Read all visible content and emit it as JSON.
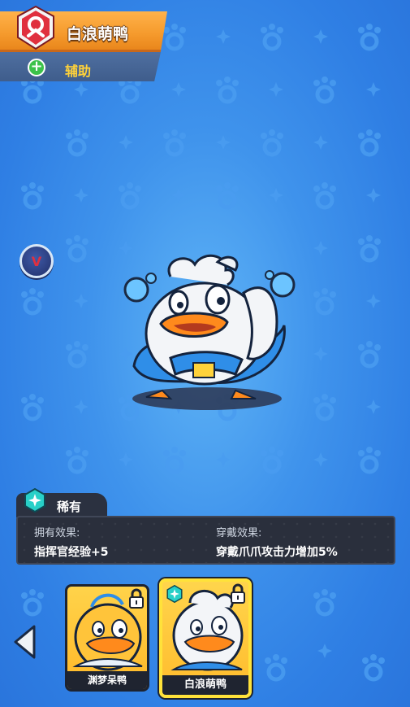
{
  "pet": {
    "name": "白浪萌鸭",
    "role": "辅助"
  },
  "rarity": {
    "label": "稀有"
  },
  "effects": {
    "own_label": "拥有效果:",
    "own_value": "指挥官经验+5",
    "wear_label": "穿戴效果:",
    "wear_value": "穿戴爪爪攻击力增加5%"
  },
  "side_button": {
    "label": "V"
  },
  "cards": [
    {
      "name": "渊梦呆鸭",
      "locked": true,
      "selected": false
    },
    {
      "name": "白浪萌鸭",
      "locked": true,
      "selected": true
    }
  ],
  "colors": {
    "background": "#3f93ec",
    "name_banner": "#f59a2c",
    "role_text": "#ffd23a",
    "panel": "#2a2f3c",
    "selected_border": "#ffe23a"
  }
}
